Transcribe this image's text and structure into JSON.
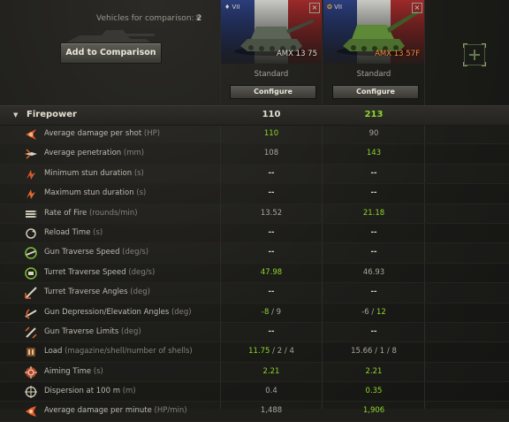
{
  "header": {
    "vehicles_label": "Vehicles for comparison:",
    "vehicles_count": "2",
    "clear_glyph": "×",
    "add_button_label": "Add to Comparison"
  },
  "vehicles": [
    {
      "tier": "VII",
      "name": "AMX 13 75",
      "premium": false,
      "config": "Standard",
      "configure_label": "Configure",
      "close": "×"
    },
    {
      "tier": "VII",
      "name": "AMX 13 57F",
      "premium": true,
      "config": "Standard",
      "configure_label": "Configure",
      "close": "×"
    }
  ],
  "section": {
    "arrow": "▼",
    "title": "Firepower",
    "values": [
      "110",
      "213"
    ],
    "best": [
      false,
      true
    ]
  },
  "rows": [
    {
      "icon": "damage-icon",
      "label": "Average damage per shot",
      "unit": "(HP)",
      "values": [
        "110",
        "90"
      ],
      "best": [
        true,
        false
      ]
    },
    {
      "icon": "penetration-icon",
      "label": "Average penetration",
      "unit": "(mm)",
      "values": [
        "108",
        "143"
      ],
      "best": [
        false,
        true
      ]
    },
    {
      "icon": "stun-min-icon",
      "label": "Minimum stun duration",
      "unit": "(s)",
      "values": [
        "--",
        "--"
      ],
      "best": [
        false,
        false
      ]
    },
    {
      "icon": "stun-max-icon",
      "label": "Maximum stun duration",
      "unit": "(s)",
      "values": [
        "--",
        "--"
      ],
      "best": [
        false,
        false
      ]
    },
    {
      "icon": "rate-of-fire-icon",
      "label": "Rate of Fire",
      "unit": "(rounds/min)",
      "values": [
        "13.52",
        "21.18"
      ],
      "best": [
        false,
        true
      ]
    },
    {
      "icon": "reload-icon",
      "label": "Reload Time",
      "unit": "(s)",
      "values": [
        "--",
        "--"
      ],
      "best": [
        false,
        false
      ]
    },
    {
      "icon": "gun-traverse-icon",
      "label": "Gun Traverse Speed",
      "unit": "(deg/s)",
      "values": [
        "--",
        "--"
      ],
      "best": [
        false,
        false
      ]
    },
    {
      "icon": "turret-traverse-icon",
      "label": "Turret Traverse Speed",
      "unit": "(deg/s)",
      "values": [
        "47.98",
        "46.93"
      ],
      "best": [
        true,
        false
      ]
    },
    {
      "icon": "turret-angles-icon",
      "label": "Turret Traverse Angles",
      "unit": "(deg)",
      "values": [
        "--",
        "--"
      ],
      "best": [
        false,
        false
      ]
    },
    {
      "icon": "gun-elevation-icon",
      "label": "Gun Depression/Elevation Angles",
      "unit": "(deg)",
      "values": [
        [
          "-8",
          "9"
        ],
        [
          "-6",
          "12"
        ]
      ],
      "best": [
        [
          true,
          false
        ],
        [
          false,
          true
        ]
      ]
    },
    {
      "icon": "gun-limits-icon",
      "label": "Gun Traverse Limits",
      "unit": "(deg)",
      "values": [
        "--",
        "--"
      ],
      "best": [
        false,
        false
      ]
    },
    {
      "icon": "load-icon",
      "label": "Load",
      "unit": "(magazine/shell/number of shells)",
      "values": [
        [
          "11.75",
          "2",
          "4"
        ],
        [
          "15.66",
          "1",
          "8"
        ]
      ],
      "best": [
        [
          true,
          false,
          false
        ],
        [
          false,
          false,
          false
        ]
      ]
    },
    {
      "icon": "aiming-time-icon",
      "label": "Aiming Time",
      "unit": "(s)",
      "values": [
        "2.21",
        "2.21"
      ],
      "best": [
        true,
        true
      ]
    },
    {
      "icon": "dispersion-icon",
      "label": "Dispersion at 100 m",
      "unit": "(m)",
      "values": [
        "0.4",
        "0.35"
      ],
      "best": [
        false,
        true
      ]
    },
    {
      "icon": "dpm-icon",
      "label": "Average damage per minute",
      "unit": "(HP/min)",
      "values": [
        "1,488",
        "1,906"
      ],
      "best": [
        false,
        true
      ]
    }
  ]
}
